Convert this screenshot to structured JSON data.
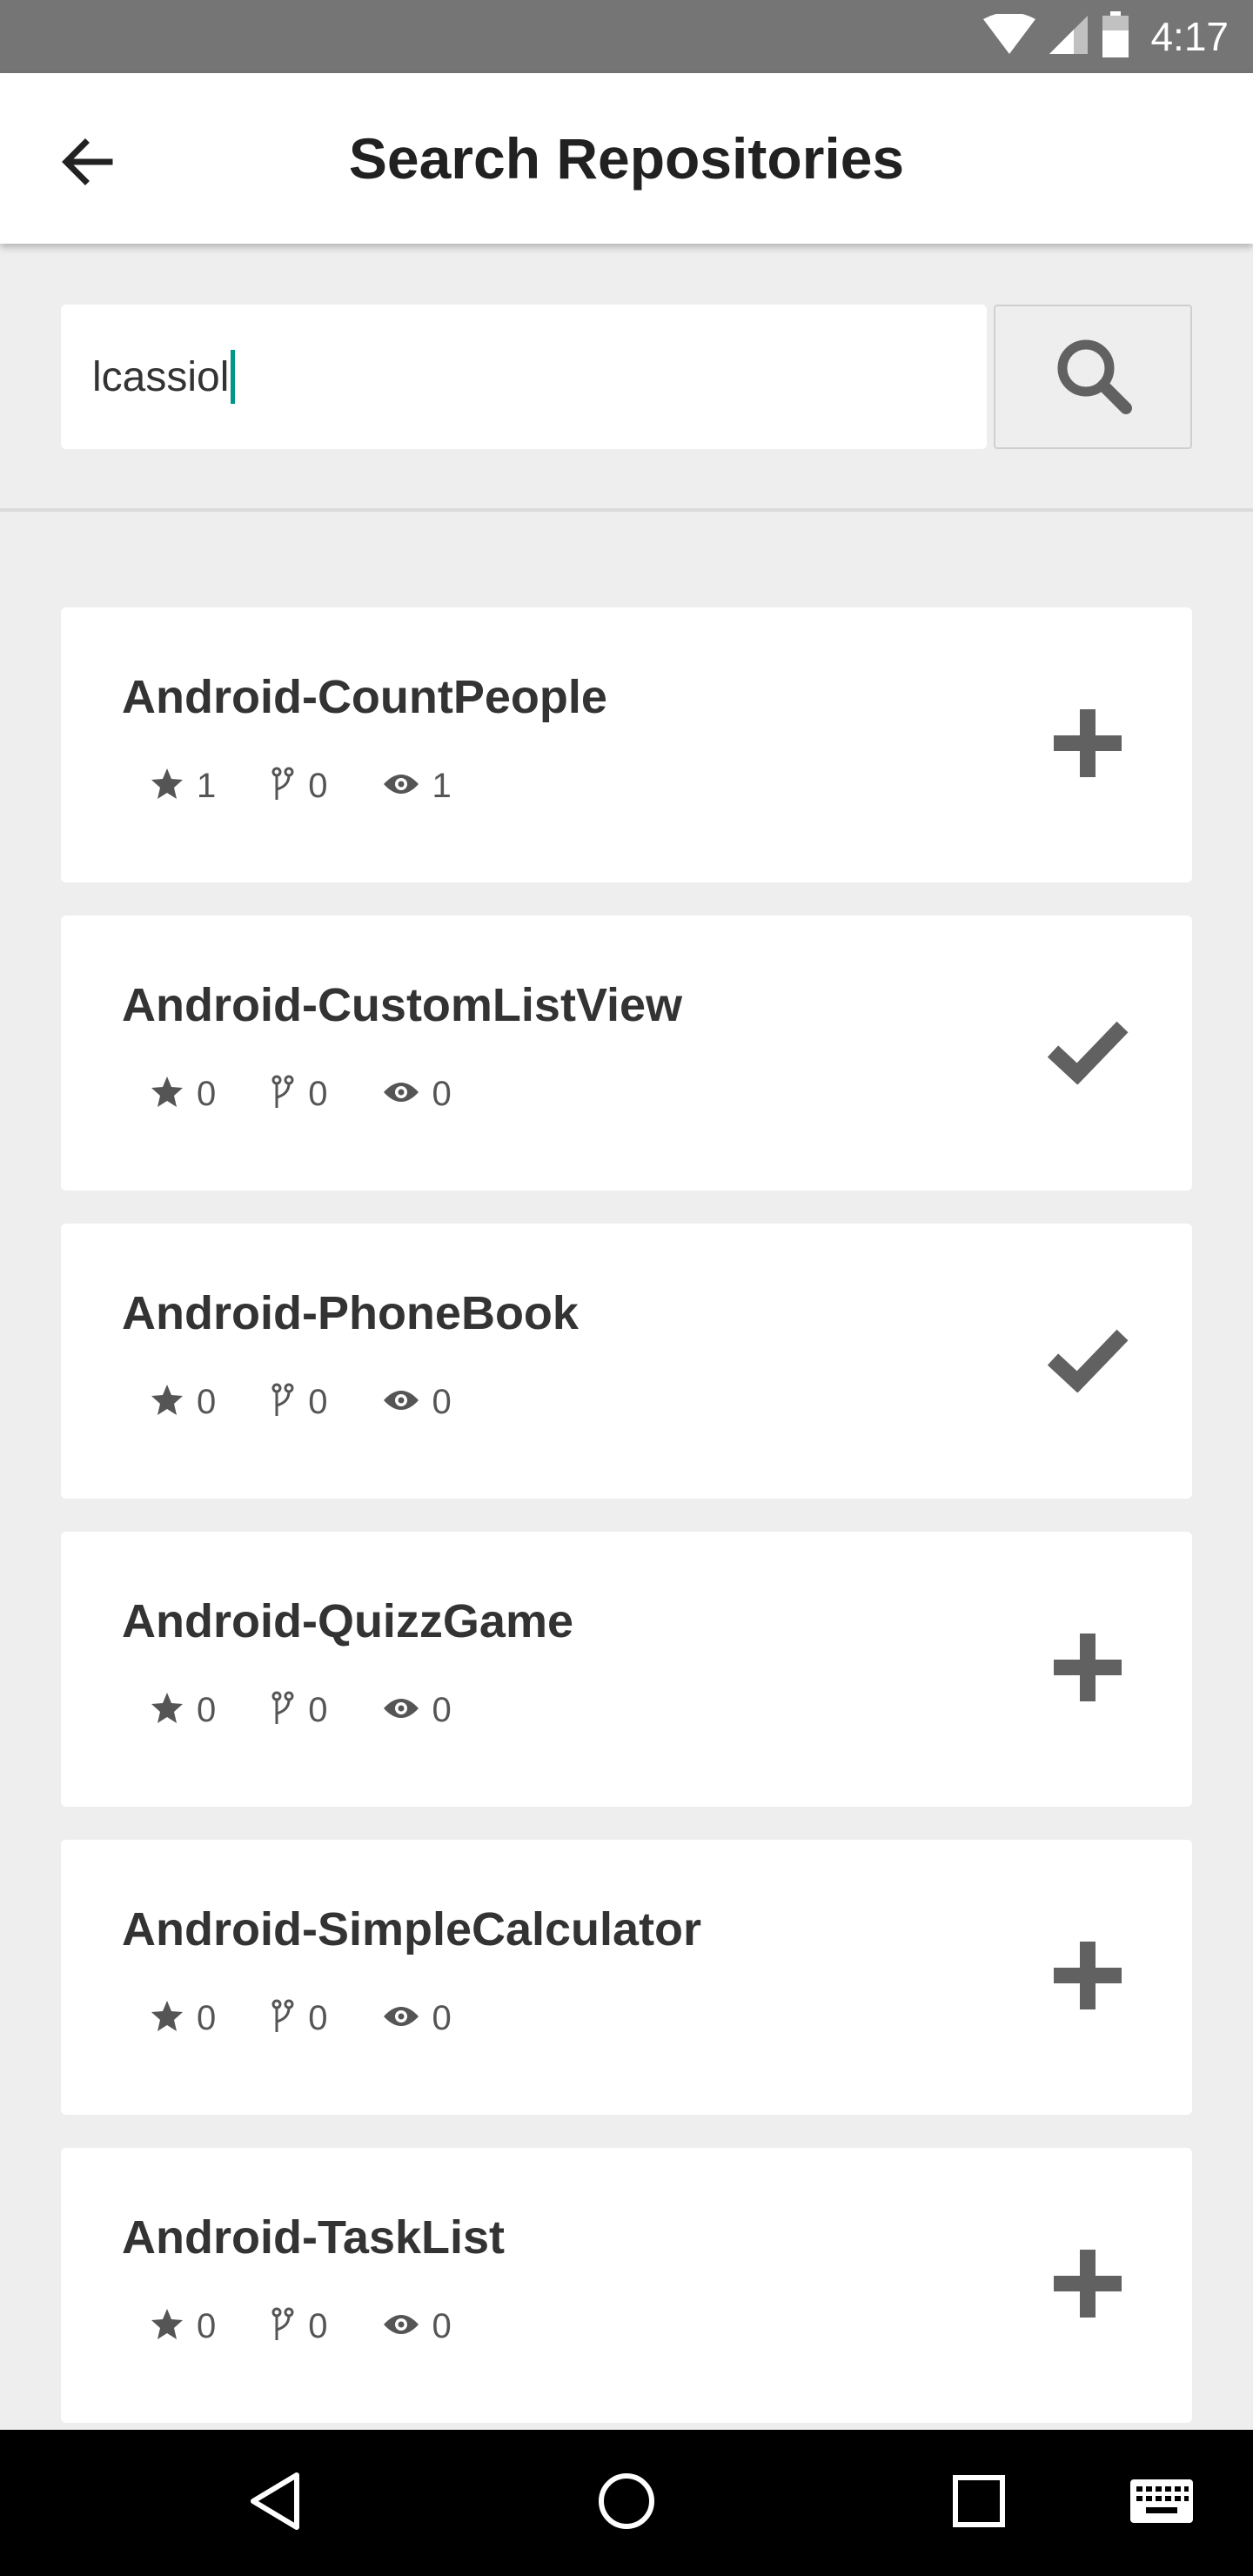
{
  "status_bar": {
    "time": "4:17"
  },
  "app_bar": {
    "title": "Search Repositories"
  },
  "search": {
    "value": "lcassiol"
  },
  "repos": [
    {
      "name": "Android-CountPeople",
      "stars": "1",
      "forks": "0",
      "watchers": "1",
      "action": "add"
    },
    {
      "name": "Android-CustomListView",
      "stars": "0",
      "forks": "0",
      "watchers": "0",
      "action": "added"
    },
    {
      "name": "Android-PhoneBook",
      "stars": "0",
      "forks": "0",
      "watchers": "0",
      "action": "added"
    },
    {
      "name": "Android-QuizzGame",
      "stars": "0",
      "forks": "0",
      "watchers": "0",
      "action": "add"
    },
    {
      "name": "Android-SimpleCalculator",
      "stars": "0",
      "forks": "0",
      "watchers": "0",
      "action": "add"
    },
    {
      "name": "Android-TaskList",
      "stars": "0",
      "forks": "0",
      "watchers": "0",
      "action": "add"
    }
  ],
  "icons": {
    "back": "arrow-back-icon",
    "search": "search-icon",
    "star": "star-icon",
    "fork": "fork-icon",
    "watch": "eye-icon",
    "add": "plus-icon",
    "added": "check-icon"
  },
  "colors": {
    "caret": "#009688",
    "status_bar": "#757575",
    "icon_gray": "#616161"
  }
}
